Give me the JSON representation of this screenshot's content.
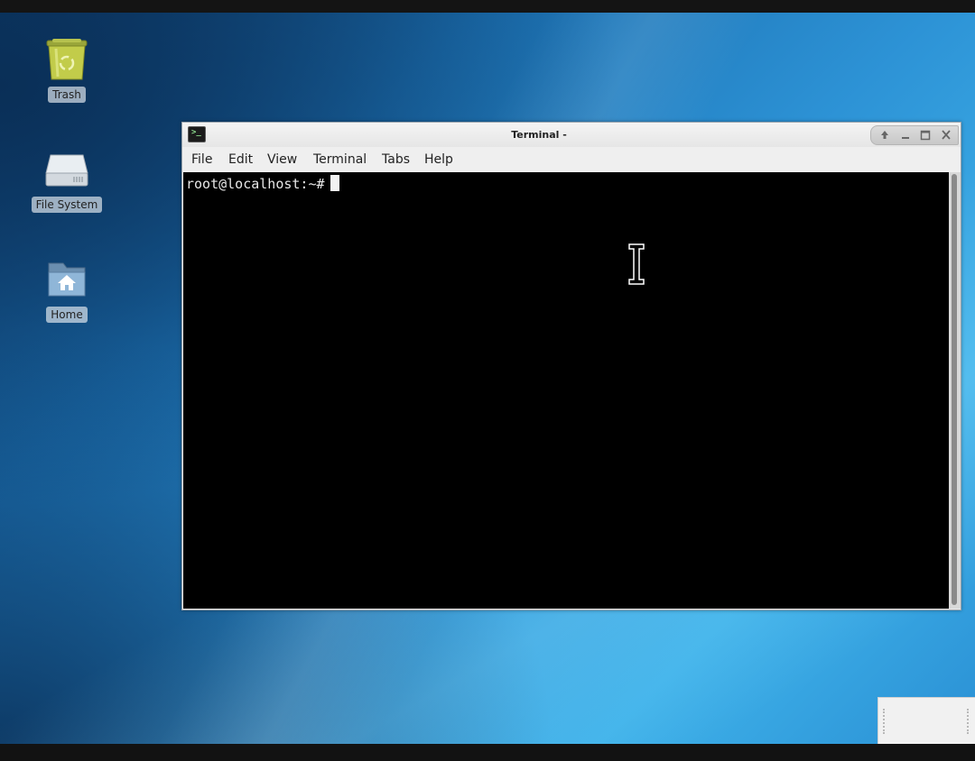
{
  "desktop": {
    "icons": [
      {
        "label": "Trash",
        "icon": "trash-icon"
      },
      {
        "label": "File System",
        "icon": "drive-icon"
      },
      {
        "label": "Home",
        "icon": "home-folder-icon"
      }
    ]
  },
  "window": {
    "title": "Terminal -",
    "icon": "terminal-icon",
    "controls": [
      "pin-up-icon",
      "minimize-icon",
      "maximize-icon",
      "close-icon"
    ],
    "menu": [
      "File",
      "Edit",
      "View",
      "Terminal",
      "Tabs",
      "Help"
    ]
  },
  "terminal": {
    "prompt": "root@localhost:~#"
  },
  "colors": {
    "terminal_bg": "#000000",
    "terminal_fg": "#e8e8e8",
    "desktop_accent": "#2d93d6"
  }
}
